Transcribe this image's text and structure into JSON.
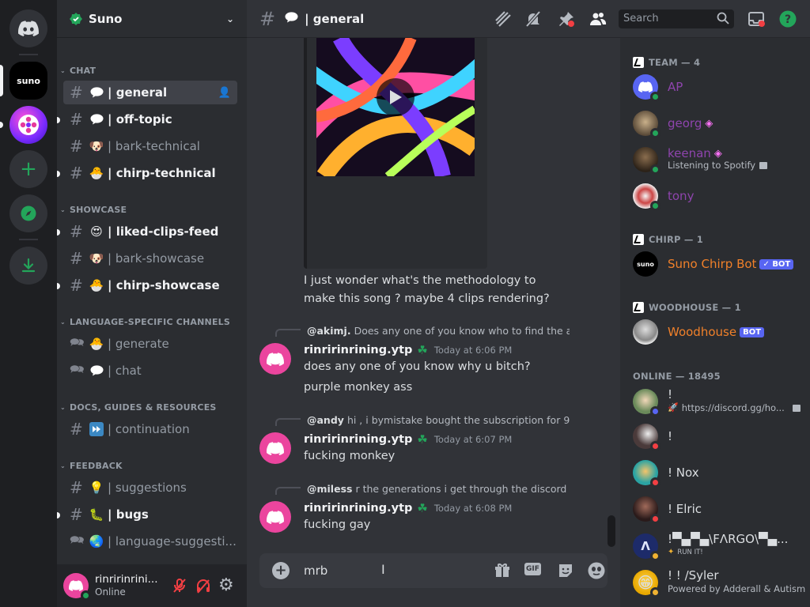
{
  "server": {
    "name": "Suno",
    "rail_label": "suno"
  },
  "categories": {
    "chat": "CHAT",
    "showcase": "SHOWCASE",
    "language": "LANGUAGE-SPECIFIC CHANNELS",
    "docs": "DOCS, GUIDES & RESOURCES",
    "feedback": "FEEDBACK"
  },
  "channels": {
    "general": "| general",
    "off_topic": "| off-topic",
    "bark_technical": "| bark-technical",
    "chirp_technical": "| chirp-technical",
    "liked_clips_feed": "| liked-clips-feed",
    "bark_showcase": "| bark-showcase",
    "chirp_showcase": "| chirp-showcase",
    "generate": "| generate",
    "chat": "| chat",
    "continuation": "| continuation",
    "suggestions": "| suggestions",
    "bugs": "| bugs",
    "language_suggestions": "| language-suggesti..."
  },
  "user": {
    "name": "rinririnrini...",
    "status": "Online"
  },
  "topbar": {
    "channel_title": "| general",
    "search_placeholder": "Search"
  },
  "messages": {
    "continued_text": "I just wonder what's the methodology to make this song ?   maybe 4 clips rendering?",
    "m1": {
      "reply_user": "@akimj.",
      "reply_text": "Does any one of you know who to find the au",
      "author": "rinririnrining.ytp",
      "timestamp": "Today at 6:06 PM",
      "lines": [
        "does any one of you know why u bitch?",
        "purple monkey ass"
      ]
    },
    "m2": {
      "reply_user": "@andy",
      "reply_text": "hi , i bymistake bought the subscription for 90",
      "author": "rinririnrining.ytp",
      "timestamp": "Today at 6:07 PM",
      "text": "fucking monkey"
    },
    "m3": {
      "reply_user": "@miless",
      "reply_text": "r the generations i get through the discord b",
      "author": "rinririnrining.ytp",
      "timestamp": "Today at 6:08 PM",
      "text": "fucking gay"
    }
  },
  "composer": {
    "value": "mrb"
  },
  "members": {
    "team_header": "TEAM — 4",
    "chirp_header": "CHIRP — 1",
    "woodhouse_header": "WOODHOUSE — 1",
    "online_header": "ONLINE — 18495",
    "bot_tag": "BOT",
    "team": [
      {
        "name": "AP"
      },
      {
        "name": "georg"
      },
      {
        "name": "keenan",
        "sub": "Listening to Spotify"
      },
      {
        "name": "tony"
      }
    ],
    "chirp_bot": {
      "name": "Suno Chirp Bot",
      "avatar_text": "suno"
    },
    "woodhouse": {
      "name": "Woodhouse"
    },
    "online": [
      {
        "name": "!",
        "sub": "https://discord.gg/ho..."
      },
      {
        "name": "!"
      },
      {
        "name": "! Nox"
      },
      {
        "name": "! Elric"
      },
      {
        "name": "!▀▄▀▄\\FΛRGO\\▀▄...",
        "sub": "RUN IT!"
      },
      {
        "name": "! ! /Syler",
        "sub": "Powered by Adderall & Autism"
      }
    ]
  },
  "colors": {
    "brand": "#5865f2",
    "online": "#23a55a",
    "dnd": "#f23f43",
    "idle": "#f0b232",
    "team_name": "#8e44ad",
    "bot_name": "#f0802a",
    "avatar_pink": "#eb459e"
  }
}
